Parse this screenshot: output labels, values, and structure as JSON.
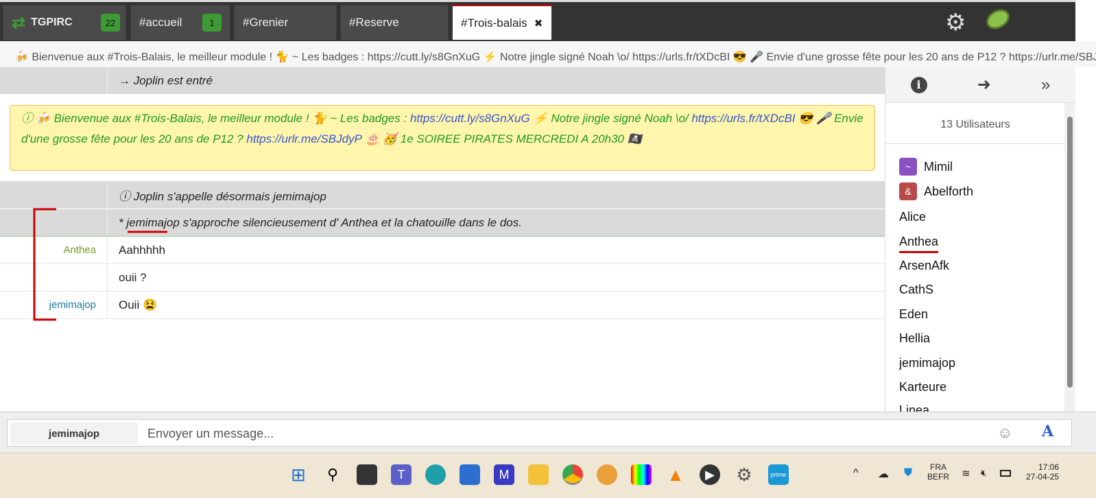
{
  "tabs": [
    {
      "label": "TGPIRC",
      "badge": "22"
    },
    {
      "label": "#accueil",
      "badge": "1"
    },
    {
      "label": "#Grenier"
    },
    {
      "label": "#Reserve"
    },
    {
      "label": "#Trois-balais",
      "close": "✖"
    }
  ],
  "topic_bar": "🍻 Bienvenue aux #Trois-Balais, le meilleur module ! 🐈 ~ Les badges : https://cutt.ly/s8GnXuG ⚡ Notre jingle signé Noah \\o/ https://urls.fr/tXDcBI 😎 🎤 Envie d'une grosse fête pour les 20 ans de P12 ? https://urlr.me/SBJdyP",
  "events": {
    "join": "→ Joplin est entré",
    "topic": {
      "p1": "ⓘ 🍻 Bienvenue aux #Trois-Balais, le meilleur module ! 🐈 ~ Les badges : ",
      "l1": "https://cutt.ly/s8GnXuG",
      "p2": " ⚡ Notre jingle signé Noah \\o/ ",
      "l2": "https://urls.fr/tXDcBI",
      "p3": " 😎 🎤 Envie d'une grosse fête pour les 20 ans de P12 ? ",
      "l3": "https://urlr.me/SBJdyP",
      "p4": " 🎂 🥳 1e SOIREE PIRATES MERCREDI A 20h30 🏴‍☠️"
    },
    "nick": "ⓘ Joplin s'appelle désormais jemimajop",
    "action": "* jemimajop s'approche silencieusement d' Anthea et la chatouille dans le dos."
  },
  "messages": [
    {
      "nick": "Anthea",
      "text": "Aahhhhh",
      "color": "#6f9a1f"
    },
    {
      "nick": "",
      "text": "ouii ?"
    },
    {
      "nick": "jemimajop",
      "text": "Ouii 😫",
      "color": "#1a7a9a"
    }
  ],
  "sidebar": {
    "count": "13 Utilisateurs",
    "users": [
      {
        "name": "Mimil",
        "mode": "~",
        "color": "#8a4fc0"
      },
      {
        "name": "Abelforth",
        "mode": "&",
        "color": "#b84a4a"
      },
      {
        "name": "Alice"
      },
      {
        "name": "Anthea"
      },
      {
        "name": "ArsenAfk"
      },
      {
        "name": "CathS"
      },
      {
        "name": "Eden"
      },
      {
        "name": "Hellia"
      },
      {
        "name": "jemimajop"
      },
      {
        "name": "Karteure"
      },
      {
        "name": "Linea"
      }
    ]
  },
  "input": {
    "nick": "jemimajop",
    "placeholder": "Envoyer un message..."
  },
  "tray": {
    "lang1": "FRA",
    "lang2": "BEFR",
    "time": "17:06",
    "date": "27-04-25"
  }
}
